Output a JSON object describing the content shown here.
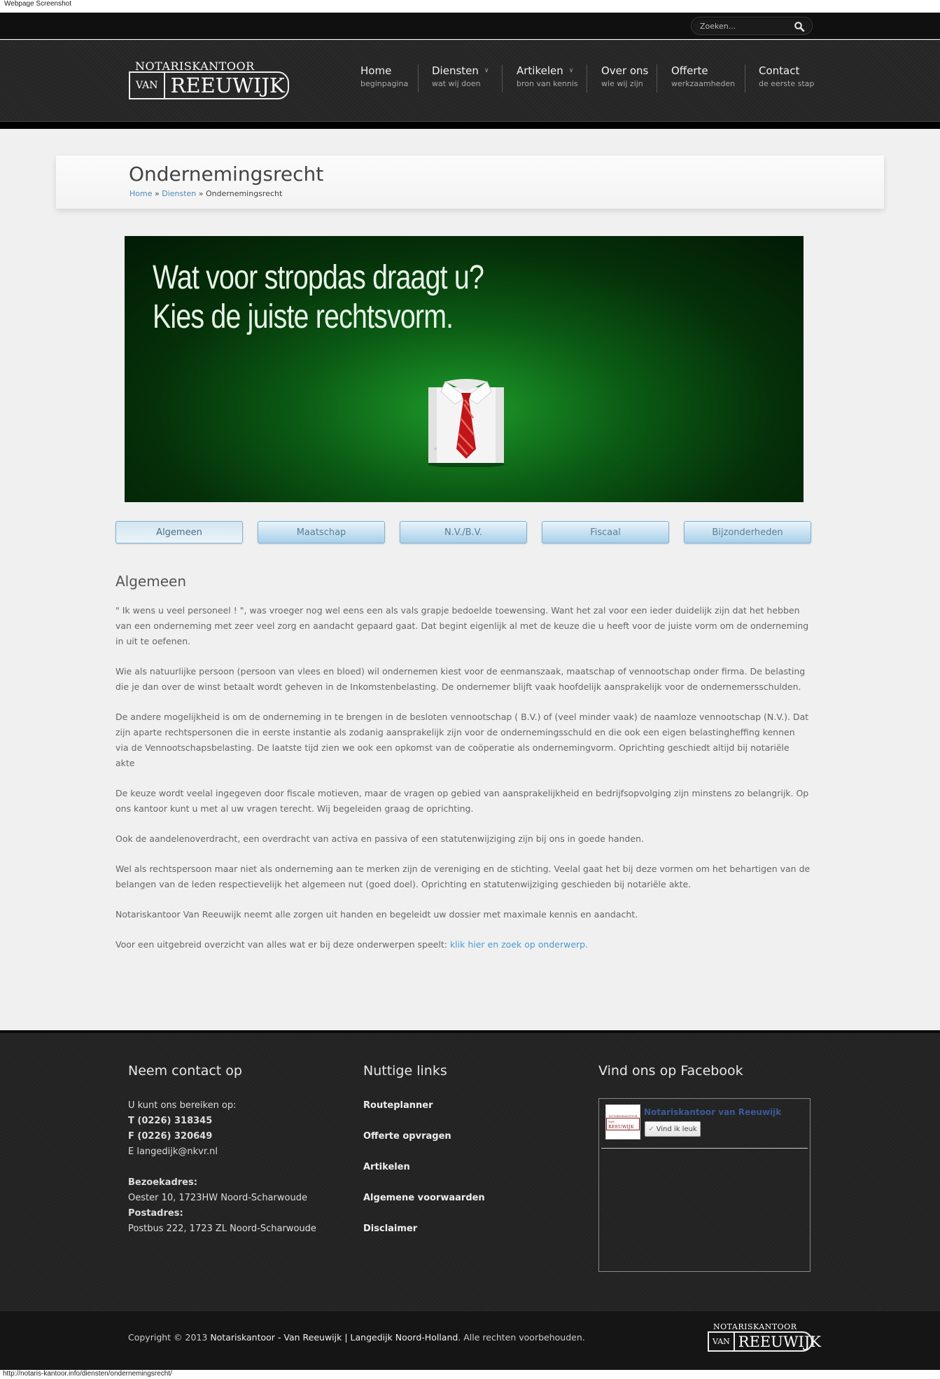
{
  "screenshot_label": "Webpage Screenshot",
  "status_url": "http://notaris-kantoor.info/diensten/ondernemingsrecht/",
  "search": {
    "placeholder": "Zoeken...",
    "icon": "search-icon"
  },
  "logo": {
    "top": "NOTARISKANTOOR",
    "van": "VAN",
    "name": "REEUWIJK"
  },
  "nav": [
    {
      "title": "Home",
      "sub": "beginpagina",
      "dropdown": false
    },
    {
      "title": "Diensten",
      "sub": "wat wij doen",
      "dropdown": true
    },
    {
      "title": "Artikelen",
      "sub": "bron van kennis",
      "dropdown": true
    },
    {
      "title": "Over ons",
      "sub": "wie wij zijn",
      "dropdown": false
    },
    {
      "title": "Offerte",
      "sub": "werkzaamheden",
      "dropdown": false
    },
    {
      "title": "Contact",
      "sub": "de eerste stap",
      "dropdown": false
    }
  ],
  "page": {
    "title": "Ondernemingsrecht",
    "breadcrumb": {
      "home": "Home",
      "sep": "»",
      "diensten": "Diensten",
      "current": "Ondernemingsrecht"
    }
  },
  "hero": {
    "line1": "Wat voor stropdas draagt u?",
    "line2": "Kies de juiste rechtsvorm.",
    "colors": {
      "primary": "#0b5a14",
      "tie": "#c0151a"
    }
  },
  "tabs": [
    {
      "label": "Algemeen",
      "active": true
    },
    {
      "label": "Maatschap",
      "active": false
    },
    {
      "label": "N.V./B.V.",
      "active": false
    },
    {
      "label": "Fiscaal",
      "active": false
    },
    {
      "label": "Bijzonderheden",
      "active": false
    }
  ],
  "article": {
    "heading": "Algemeen",
    "paragraphs": [
      "\" Ik wens u veel personeel ! \", was vroeger nog wel eens een als vals grapje bedoelde toewensing. Want het zal voor een ieder duidelijk zijn dat het hebben van een onderneming met zeer veel zorg en aandacht gepaard gaat. Dat begint eigenlijk al met de keuze die u heeft voor de juiste vorm om de onderneming in uit te oefenen.",
      "Wie als natuurlijke persoon (persoon van vlees en bloed) wil ondernemen kiest voor de eenmanszaak, maatschap of vennootschap onder firma. De belasting die je dan over de winst betaalt wordt geheven in de Inkomstenbelasting. De ondernemer blijft vaak hoofdelijk aansprakelijk voor de ondernemersschulden.",
      "De andere mogelijkheid is om de onderneming in te brengen in de besloten vennootschap ( B.V.) of (veel minder vaak) de naamloze vennootschap (N.V.). Dat zijn aparte rechtspersonen die in eerste instantie als zodanig aansprakelijk zijn voor de ondernemingsschuld en die ook een eigen belastingheffing kennen via de Vennootschapsbelasting. De laatste tijd zien we ook een opkomst van de coöperatie als ondernemingvorm. Oprichting geschiedt altijd bij notariële akte",
      "De keuze wordt veelal ingegeven door fiscale motieven, maar de vragen op gebied van aansprakelijkheid en bedrijfsopvolging zijn minstens zo belangrijk. Op ons kantoor kunt u met al uw vragen terecht. Wij begeleiden graag de oprichting.",
      "Ook de aandelenoverdracht, een overdracht van activa en passiva of een statutenwijziging zijn bij ons in goede handen.",
      "Wel als rechtspersoon maar niet als onderneming aan te merken zijn de vereniging en de stichting. Veelal gaat het bij deze vormen om het behartigen van de belangen van de leden respectievelijk het algemeen nut (goed doel). Oprichting en statutenwijziging geschieden bij notariële akte.",
      "Notariskantoor Van Reeuwijk neemt alle zorgen uit handen en begeleidt uw dossier met maximale kennis en aandacht."
    ],
    "last_paragraph_text": "Voor een uitgebreid overzicht van alles wat er bij deze onderwerpen speelt: ",
    "last_paragraph_link": "klik hier en zoek op onderwerp."
  },
  "footer": {
    "contact": {
      "heading": "Neem contact op",
      "intro": "U kunt ons bereiken op:",
      "phone": "T (0226) 318345",
      "fax": "F (0226) 320649",
      "email": "E langedijk@nkvr.nl",
      "visit_label": "Bezoekadres:",
      "visit_address": "Oester 10, 1723HW Noord-Scharwoude",
      "post_label": "Postadres:",
      "post_address": "Postbus 222, 1723 ZL Noord-Scharwoude"
    },
    "links": {
      "heading": "Nuttige links",
      "items": [
        "Routeplanner",
        "Offerte opvragen",
        "Artikelen",
        "Algemene voorwaarden",
        "Disclaimer"
      ]
    },
    "facebook": {
      "heading": "Vind ons op Facebook",
      "page_name": "Notariskantoor van Reeuwijk",
      "like_label": "Vind ik leuk"
    },
    "copyright": {
      "prefix": "Copyright © 2013 ",
      "name": "Notariskantoor - Van Reeuwijk | Langedijk Noord-Holland",
      "suffix": ". Alle rechten voorbehouden."
    }
  }
}
